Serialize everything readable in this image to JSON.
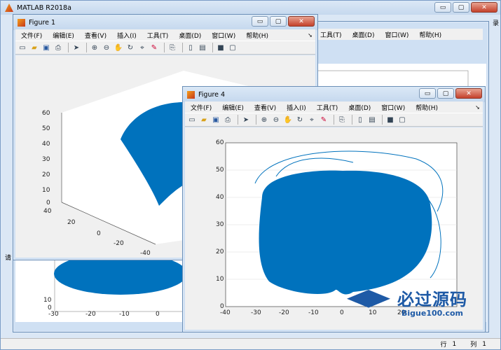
{
  "main_window": {
    "title": "MATLAB R2018a",
    "status_row_label": "行",
    "status_row_value": "1",
    "status_col_label": "列",
    "status_col_value": "1",
    "side_label": "录",
    "bottom_left_label": "请"
  },
  "menu": [
    "文件(F)",
    "编辑(E)",
    "查看(V)",
    "插入(I)",
    "工具(T)",
    "桌面(D)",
    "窗口(W)",
    "帮助(H)"
  ],
  "icons": [
    "new-file-icon",
    "open-folder-icon",
    "save-icon",
    "print-icon",
    "pointer-icon",
    "zoom-in-icon",
    "zoom-out-icon",
    "pan-icon",
    "rotate-icon",
    "data-cursor-icon",
    "brush-icon",
    "link-icon",
    "insert-colorbar-icon",
    "insert-legend-icon",
    "hide-tools-icon",
    "show-tools-icon"
  ],
  "window_controls": {
    "minimize": "▭",
    "maximize": "▢",
    "close": "✕"
  },
  "figure1": {
    "title": "Figure 1",
    "z_ticks": [
      "60",
      "50",
      "40",
      "30",
      "20",
      "10",
      "0"
    ],
    "x_ticks": [
      "40",
      "20",
      "0",
      "-20",
      "-40"
    ]
  },
  "figure4": {
    "title": "Figure 4",
    "y_ticks": [
      "60",
      "50",
      "40",
      "30",
      "20",
      "10",
      "0"
    ],
    "x_ticks": [
      "-40",
      "-30",
      "-20",
      "-10",
      "0",
      "10",
      "20"
    ]
  },
  "background_figure": {
    "y_ticks": [
      "10",
      "0"
    ],
    "x_ticks": [
      "-30",
      "-20",
      "-10",
      "0"
    ]
  },
  "watermark": {
    "text": "必过源码",
    "url": "Bigue100.com"
  },
  "colors": {
    "plot": "#0072bd",
    "title_bar": "#cfe0f3",
    "desktop": "#b9d1ea"
  },
  "chart_data": [
    {
      "type": "line",
      "title": "",
      "xlabel": "",
      "ylabel": "",
      "xlim": [
        -40,
        20
      ],
      "ylim": [
        0,
        60
      ],
      "series": [
        {
          "x": [
            -10,
            -25,
            -30,
            -22,
            -10,
            0,
            10,
            15,
            12,
            0,
            -10
          ],
          "y": [
            5,
            10,
            25,
            40,
            48,
            50,
            45,
            30,
            15,
            8,
            5
          ]
        }
      ]
    },
    {
      "type": "line",
      "title": "",
      "xlabel": "",
      "ylabel": "",
      "ylim": [
        0,
        60
      ],
      "series": [
        {
          "x": [
            -20,
            0,
            20,
            0
          ],
          "y": [
            10,
            55,
            20,
            0
          ]
        }
      ]
    }
  ]
}
